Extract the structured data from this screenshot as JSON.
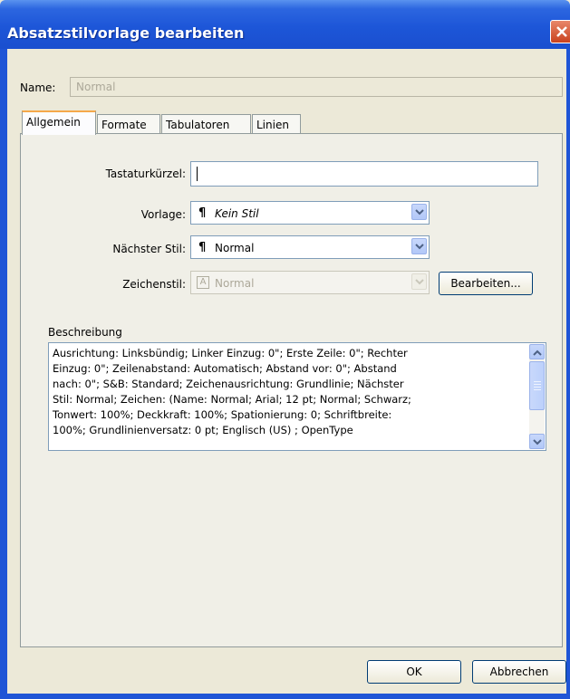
{
  "window": {
    "title": "Absatzstilvorlage bearbeiten"
  },
  "name": {
    "label": "Name:",
    "value": "Normal"
  },
  "tabs": [
    {
      "label": "Allgemein",
      "active": true
    },
    {
      "label": "Formate",
      "active": false
    },
    {
      "label": "Tabulatoren",
      "active": false
    },
    {
      "label": "Linien",
      "active": false
    }
  ],
  "general": {
    "shortcut": {
      "label": "Tastaturkürzel:",
      "value": ""
    },
    "based_on": {
      "label": "Vorlage:",
      "value": "Kein Stil"
    },
    "next_style": {
      "label": "Nächster Stil:",
      "value": "Normal"
    },
    "char_style": {
      "label": "Zeichenstil:",
      "value": "Normal",
      "disabled": true
    },
    "edit_button": "Bearbeiten...",
    "description_label": "Beschreibung",
    "description_lines": [
      "Ausrichtung: Linksbündig;  Linker Einzug: 0\";  Erste Zeile: 0\";  Rechter",
      "Einzug: 0\";  Zeilenabstand: Automatisch;  Abstand vor: 0\";  Abstand",
      "nach: 0\";  S&B: Standard;  Zeichenausrichtung: Grundlinie;  Nächster",
      "Stil: Normal;  Zeichen: (Name: Normal;  Arial;  12 pt;  Normal;  Schwarz;",
      "  Tonwert: 100%;  Deckkraft: 100%;  Spationierung: 0;  Schriftbreite:",
      "100%;  Grundlinienversatz: 0 pt;  Englisch (US) ;  OpenType"
    ]
  },
  "footer": {
    "ok": "OK",
    "cancel": "Abbrechen"
  },
  "colors": {
    "titlebar": "#1d56d8",
    "dialog_bg": "#ece9d8",
    "active_tab_accent": "#f5a84a",
    "control_border": "#7f9db9"
  },
  "icons": {
    "close": "close-icon",
    "pilcrow": "¶",
    "dropdown": "chevron-down-icon",
    "char_style": "A"
  }
}
